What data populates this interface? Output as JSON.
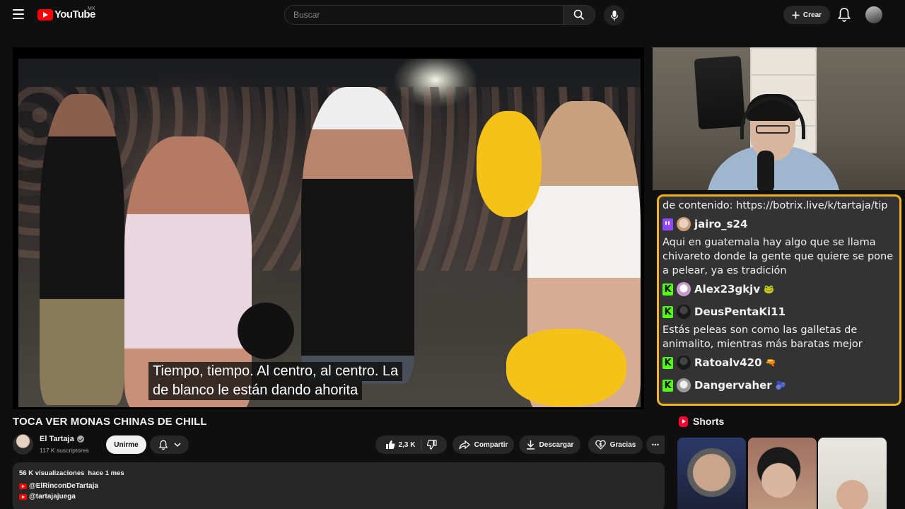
{
  "header": {
    "logo_text": "YouTube",
    "logo_country": "MX",
    "search_placeholder": "Buscar",
    "create_label": "Crear"
  },
  "video": {
    "subtitle_line1": "Tiempo, tiempo. Al centro, al centro. La",
    "subtitle_line2": "de blanco le están dando ahorita",
    "title": "TOCA VER MONAS CHINAS DE CHILL"
  },
  "channel": {
    "name": "El Tartaja",
    "subscribers": "117 K suscriptores",
    "join_label": "Unirme"
  },
  "actions": {
    "likes": "2,3 K",
    "share_label": "Compartir",
    "download_label": "Descargar",
    "thanks_label": "Gracias"
  },
  "description": {
    "views": "56 K visualizaciones",
    "date": "hace 1 mes",
    "links": [
      "@ElRinconDeTartaja",
      "@tartajajuega"
    ]
  },
  "chat": {
    "line0": "de contenido: https://botrix.live/k/tartaja/tip",
    "messages": [
      {
        "platform": "twitch",
        "user": "jairo_s24",
        "text": "Aqui en guatemala hay algo que se llama chivareto donde la gente que quiere se pone a pelear, ya es tradición"
      },
      {
        "platform": "kick",
        "user": "Alex23gkjv",
        "text": ""
      },
      {
        "platform": "kick",
        "user": "DeusPentaKi11",
        "text": "Estás peleas son como las galletas de animalito, mientras más baratas mejor"
      },
      {
        "platform": "kick",
        "user": "Ratoalv420",
        "text": ""
      },
      {
        "platform": "kick",
        "user": "Dangervaher",
        "text": ""
      }
    ]
  },
  "shorts": {
    "title": "Shorts"
  },
  "colors": {
    "chat_border": "#f2b41d",
    "kick": "#53fc18",
    "twitch": "#9146ff",
    "youtube_red": "#ff0000"
  }
}
